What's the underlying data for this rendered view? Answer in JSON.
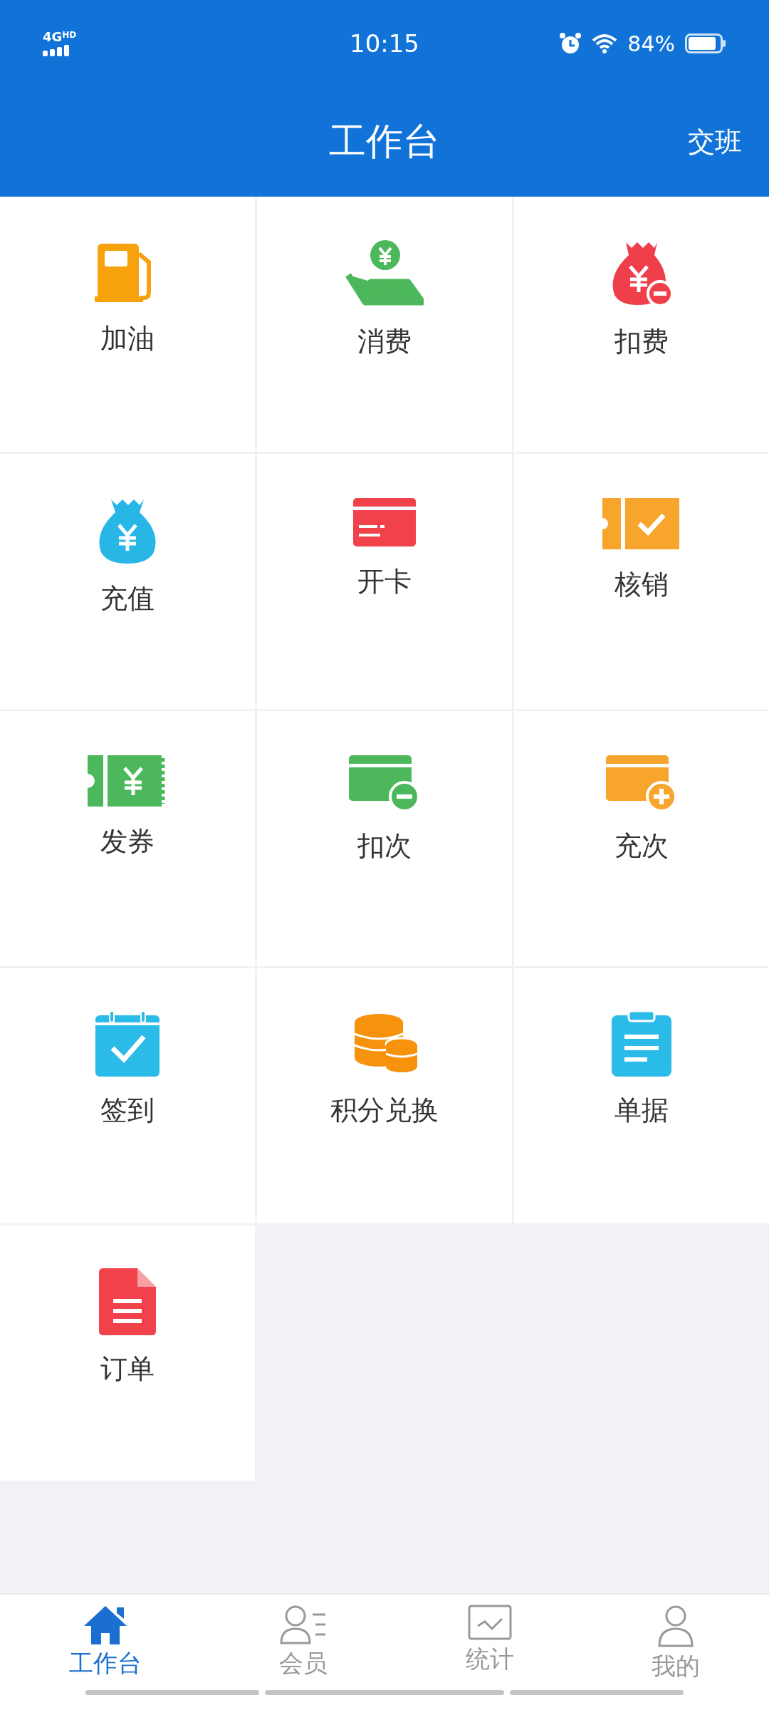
{
  "status_bar": {
    "network": "4G",
    "network_extra": "HD",
    "time": "10:15",
    "battery": "84%"
  },
  "header": {
    "title": "工作台",
    "action": "交班"
  },
  "tiles": [
    {
      "label": "加油"
    },
    {
      "label": "消费"
    },
    {
      "label": "扣费"
    },
    {
      "label": "充值"
    },
    {
      "label": "开卡"
    },
    {
      "label": "核销"
    },
    {
      "label": "发券"
    },
    {
      "label": "扣次"
    },
    {
      "label": "充次"
    },
    {
      "label": "签到"
    },
    {
      "label": "积分兑换"
    },
    {
      "label": "单据"
    },
    {
      "label": "订单"
    }
  ],
  "tabs": [
    {
      "label": "工作台",
      "selected": true
    },
    {
      "label": "会员",
      "selected": false
    },
    {
      "label": "统计",
      "selected": false
    },
    {
      "label": "我的",
      "selected": false
    }
  ]
}
